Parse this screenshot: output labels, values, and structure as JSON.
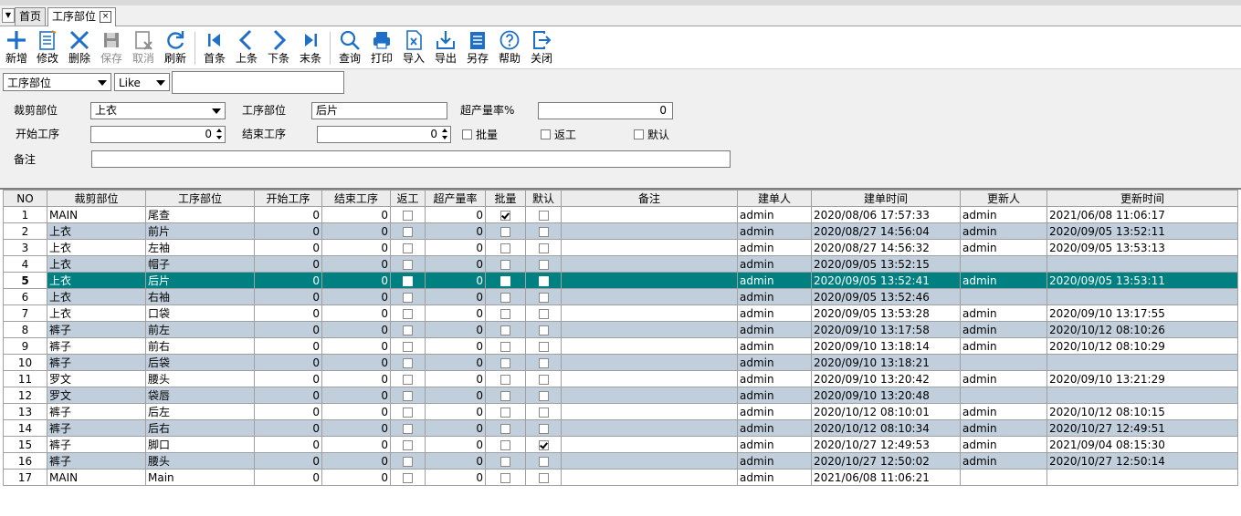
{
  "tabs": {
    "home_label": "首页",
    "active_label": "工序部位",
    "close_glyph": "×",
    "menu_glyph": "▼"
  },
  "toolbar": {
    "new_label": "新增",
    "edit_label": "修改",
    "delete_label": "删除",
    "save_label": "保存",
    "cancel_label": "取消",
    "refresh_label": "刷新",
    "first_label": "首条",
    "prev_label": "上条",
    "next_label": "下条",
    "last_label": "末条",
    "query_label": "查询",
    "print_label": "打印",
    "import_label": "导入",
    "export_label": "导出",
    "saveas_label": "另存",
    "help_label": "帮助",
    "close_label": "关闭"
  },
  "search": {
    "field_value": "工序部位",
    "operator_value": "Like",
    "keyword_value": ""
  },
  "form": {
    "cut_part_label": "裁剪部位",
    "cut_part_value": "上衣",
    "process_part_label": "工序部位",
    "process_part_value": "后片",
    "overrate_label": "超产量率%",
    "overrate_value": "0",
    "start_label": "开始工序",
    "start_value": "0",
    "end_label": "结束工序",
    "end_value": "0",
    "batch_label": "批量",
    "rework_label": "返工",
    "default_label": "默认",
    "remark_label": "备注",
    "remark_value": ""
  },
  "grid": {
    "columns": [
      "NO",
      "裁剪部位",
      "工序部位",
      "开始工序",
      "结束工序",
      "返工",
      "超产量率",
      "批量",
      "默认",
      "备注",
      "建单人",
      "建单时间",
      "更新人",
      "更新时间"
    ],
    "rows": [
      {
        "no": "1",
        "cut": "MAIN",
        "part": "尾查",
        "start": "0",
        "end": "0",
        "rework": false,
        "rate": "0",
        "batch": true,
        "def": false,
        "remark": "",
        "creator": "admin",
        "created": "2020/08/06 17:57:33",
        "updater": "admin",
        "updated": "2021/06/08 11:06:17"
      },
      {
        "no": "2",
        "cut": "上衣",
        "part": "前片",
        "start": "0",
        "end": "0",
        "rework": false,
        "rate": "0",
        "batch": false,
        "def": false,
        "remark": "",
        "creator": "admin",
        "created": "2020/08/27 14:56:04",
        "updater": "admin",
        "updated": "2020/09/05 13:52:11"
      },
      {
        "no": "3",
        "cut": "上衣",
        "part": "左袖",
        "start": "0",
        "end": "0",
        "rework": false,
        "rate": "0",
        "batch": false,
        "def": false,
        "remark": "",
        "creator": "admin",
        "created": "2020/08/27 14:56:32",
        "updater": "admin",
        "updated": "2020/09/05 13:53:13"
      },
      {
        "no": "4",
        "cut": "上衣",
        "part": "帽子",
        "start": "0",
        "end": "0",
        "rework": false,
        "rate": "0",
        "batch": false,
        "def": false,
        "remark": "",
        "creator": "admin",
        "created": "2020/09/05 13:52:15",
        "updater": "",
        "updated": ""
      },
      {
        "no": "5",
        "cut": "上衣",
        "part": "后片",
        "start": "0",
        "end": "0",
        "rework": false,
        "rate": "0",
        "batch": false,
        "def": false,
        "remark": "",
        "creator": "admin",
        "created": "2020/09/05 13:52:41",
        "updater": "admin",
        "updated": "2020/09/05 13:53:11"
      },
      {
        "no": "6",
        "cut": "上衣",
        "part": "右袖",
        "start": "0",
        "end": "0",
        "rework": false,
        "rate": "0",
        "batch": false,
        "def": false,
        "remark": "",
        "creator": "admin",
        "created": "2020/09/05 13:52:46",
        "updater": "",
        "updated": ""
      },
      {
        "no": "7",
        "cut": "上衣",
        "part": "口袋",
        "start": "0",
        "end": "0",
        "rework": false,
        "rate": "0",
        "batch": false,
        "def": false,
        "remark": "",
        "creator": "admin",
        "created": "2020/09/05 13:53:28",
        "updater": "admin",
        "updated": "2020/09/10 13:17:55"
      },
      {
        "no": "8",
        "cut": "裤子",
        "part": "前左",
        "start": "0",
        "end": "0",
        "rework": false,
        "rate": "0",
        "batch": false,
        "def": false,
        "remark": "",
        "creator": "admin",
        "created": "2020/09/10 13:17:58",
        "updater": "admin",
        "updated": "2020/10/12 08:10:26"
      },
      {
        "no": "9",
        "cut": "裤子",
        "part": "前右",
        "start": "0",
        "end": "0",
        "rework": false,
        "rate": "0",
        "batch": false,
        "def": false,
        "remark": "",
        "creator": "admin",
        "created": "2020/09/10 13:18:14",
        "updater": "admin",
        "updated": "2020/10/12 08:10:29"
      },
      {
        "no": "10",
        "cut": "裤子",
        "part": "后袋",
        "start": "0",
        "end": "0",
        "rework": false,
        "rate": "0",
        "batch": false,
        "def": false,
        "remark": "",
        "creator": "admin",
        "created": "2020/09/10 13:18:21",
        "updater": "",
        "updated": ""
      },
      {
        "no": "11",
        "cut": "罗文",
        "part": "腰头",
        "start": "0",
        "end": "0",
        "rework": false,
        "rate": "0",
        "batch": false,
        "def": false,
        "remark": "",
        "creator": "admin",
        "created": "2020/09/10 13:20:42",
        "updater": "admin",
        "updated": "2020/09/10 13:21:29"
      },
      {
        "no": "12",
        "cut": "罗文",
        "part": "袋唇",
        "start": "0",
        "end": "0",
        "rework": false,
        "rate": "0",
        "batch": false,
        "def": false,
        "remark": "",
        "creator": "admin",
        "created": "2020/09/10 13:20:48",
        "updater": "",
        "updated": ""
      },
      {
        "no": "13",
        "cut": "裤子",
        "part": "后左",
        "start": "0",
        "end": "0",
        "rework": false,
        "rate": "0",
        "batch": false,
        "def": false,
        "remark": "",
        "creator": "admin",
        "created": "2020/10/12 08:10:01",
        "updater": "admin",
        "updated": "2020/10/12 08:10:15"
      },
      {
        "no": "14",
        "cut": "裤子",
        "part": "后右",
        "start": "0",
        "end": "0",
        "rework": false,
        "rate": "0",
        "batch": false,
        "def": false,
        "remark": "",
        "creator": "admin",
        "created": "2020/10/12 08:10:34",
        "updater": "admin",
        "updated": "2020/10/27 12:49:51"
      },
      {
        "no": "15",
        "cut": "裤子",
        "part": "脚口",
        "start": "0",
        "end": "0",
        "rework": false,
        "rate": "0",
        "batch": false,
        "def": true,
        "remark": "",
        "creator": "admin",
        "created": "2020/10/27 12:49:53",
        "updater": "admin",
        "updated": "2021/09/04 08:15:30"
      },
      {
        "no": "16",
        "cut": "裤子",
        "part": "腰头",
        "start": "0",
        "end": "0",
        "rework": false,
        "rate": "0",
        "batch": false,
        "def": false,
        "remark": "",
        "creator": "admin",
        "created": "2020/10/27 12:50:02",
        "updater": "admin",
        "updated": "2020/10/27 12:50:14"
      },
      {
        "no": "17",
        "cut": "MAIN",
        "part": "Main",
        "start": "0",
        "end": "0",
        "rework": false,
        "rate": "0",
        "batch": false,
        "def": false,
        "remark": "",
        "creator": "admin",
        "created": "2021/06/08 11:06:21",
        "updater": "",
        "updated": ""
      }
    ],
    "selected_no": "5"
  },
  "colors": {
    "selected_row": "#008080",
    "alt_row": "#c1cfdd",
    "icon_blue": "#1e6fc8",
    "icon_disabled": "#8c8c8c"
  }
}
